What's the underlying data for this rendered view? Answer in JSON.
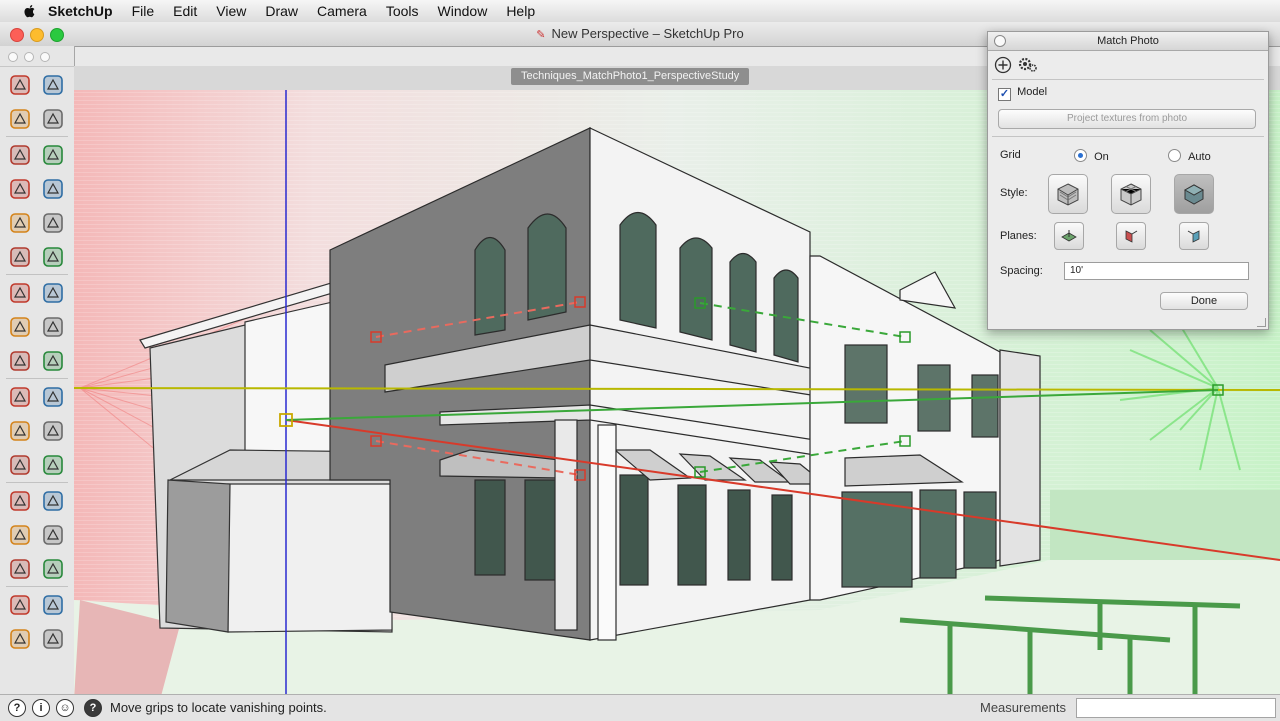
{
  "menubar": {
    "app_name": "SketchUp",
    "items": [
      "File",
      "Edit",
      "View",
      "Draw",
      "Camera",
      "Tools",
      "Window",
      "Help"
    ]
  },
  "window": {
    "title": "New Perspective – SketchUp Pro",
    "scene_tab": "Techniques_MatchPhoto1_PerspectiveStudy"
  },
  "toolbar": {
    "icons": [
      "select-icon",
      "component-icon",
      "paint-bucket-icon",
      "eraser-icon",
      "rectangle-icon",
      "line-icon",
      "circle-icon",
      "freehand-icon",
      "polygon-icon",
      "arc-icon",
      "pie-icon",
      "two-point-arc-icon",
      "move-icon",
      "push-pull-icon",
      "rotate-icon",
      "follow-me-icon",
      "scale-icon",
      "offset-icon",
      "tape-measure-icon",
      "dimension-icon",
      "protractor-icon",
      "text-icon",
      "axes-icon",
      "3d-text-icon",
      "orbit-icon",
      "pan-icon",
      "zoom-icon",
      "zoom-window-icon",
      "zoom-extents-icon",
      "previous-view-icon",
      "walk-icon",
      "position-camera-icon",
      "look-around-icon",
      "section-plane-icon"
    ]
  },
  "match_photo": {
    "title": "Match Photo",
    "add_icon": "add-photo-icon",
    "settings_icon": "settings-icon",
    "model_label": "Model",
    "model_checked": true,
    "project_button": "Project textures from photo",
    "grid_label": "Grid",
    "grid_on": "On",
    "grid_auto": "Auto",
    "grid_selected": "On",
    "style_label": "Style:",
    "planes_label": "Planes:",
    "spacing_label": "Spacing:",
    "spacing_value": "10'",
    "done_button": "Done"
  },
  "statusbar": {
    "message": "Move grips to locate vanishing points.",
    "measurements_label": "Measurements",
    "measurements_value": ""
  },
  "colors": {
    "red_axis": "#d83a2a",
    "green_axis": "#3aa83a",
    "blue_axis": "#2a2ad0",
    "horizon": "#b8b800",
    "green_grid": "#7ee07e",
    "red_grid": "#f07a7a"
  }
}
